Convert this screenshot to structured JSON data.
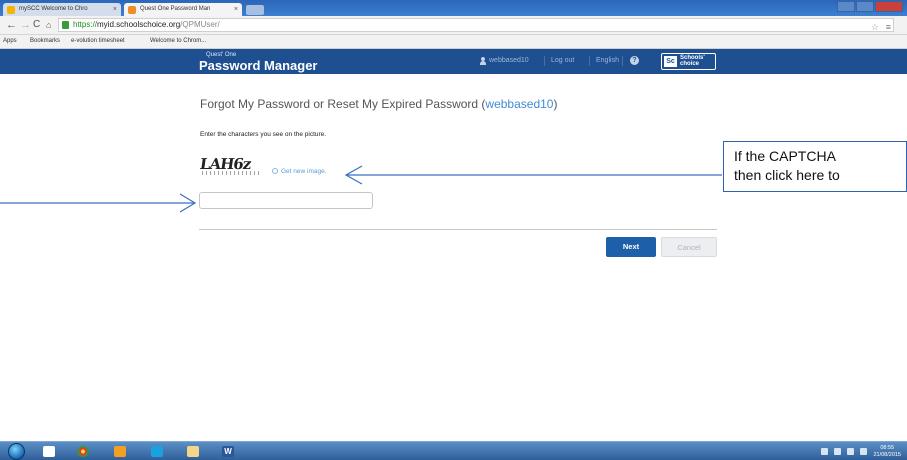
{
  "browser": {
    "tabs": [
      {
        "label": "mySCC Welcome to Chro"
      },
      {
        "label": "Quest One Password Man"
      }
    ],
    "address": {
      "scheme": "https://",
      "host": "myid.schoolschoice.org",
      "path": "/QPMUser/"
    },
    "bookmarks": [
      "Apps",
      "Bookmarks",
      "e-volution timesheet",
      "Welcome to Chrom...",
      ""
    ]
  },
  "header": {
    "brand_small": "Quest' One",
    "brand_title": "Password Manager",
    "username": "webbased10",
    "logout": "Log out",
    "language": "English",
    "help": "?",
    "logo_abbr": "Sc",
    "logo_line1": "Schools'",
    "logo_line2": "choice"
  },
  "main": {
    "heading_prefix": "Forgot My Password or Reset My Expired Password (",
    "heading_user": "webbased10",
    "heading_suffix": ")",
    "instruction": "Enter the characters you see on the picture.",
    "captcha_text": "LAH6z",
    "refresh_label": "Get new image.",
    "input_value": "",
    "next_label": "Next",
    "cancel_label": "Cancel"
  },
  "callout": {
    "line1": "If the CAPTCHA",
    "line2": "then click here to"
  },
  "taskbar": {
    "clock_time": "08:55",
    "clock_date": "21/08/2015"
  },
  "colors": {
    "header_bg": "#1d4f91",
    "link": "#3f8cd6",
    "next_button": "#1d5fa8",
    "callout_border": "#2d63b0"
  }
}
